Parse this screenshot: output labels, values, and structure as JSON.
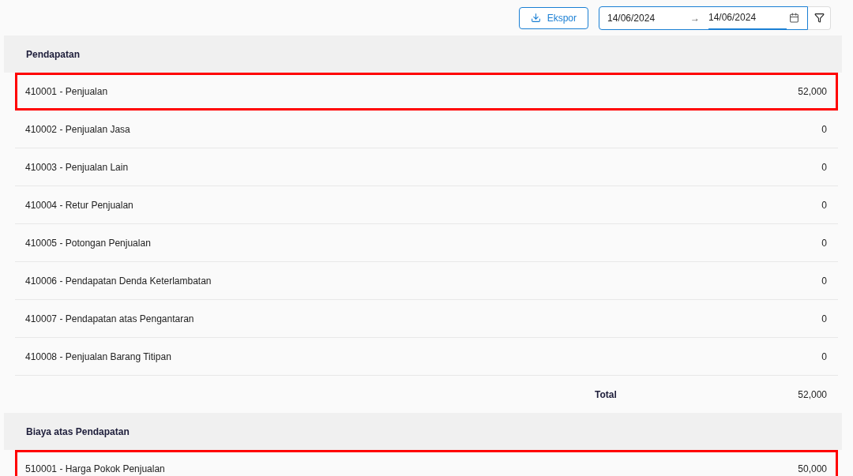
{
  "toolbar": {
    "export_label": "Ekspor",
    "date_from": "14/06/2024",
    "separator": "→",
    "date_to": "14/06/2024"
  },
  "sections": [
    {
      "title": "Pendapatan",
      "rows": [
        {
          "label": "410001 - Penjualan",
          "amount": "52,000",
          "highlighted": true
        },
        {
          "label": "410002 - Penjualan Jasa",
          "amount": "0",
          "highlighted": false
        },
        {
          "label": "410003 - Penjualan Lain",
          "amount": "0",
          "highlighted": false
        },
        {
          "label": "410004 - Retur Penjualan",
          "amount": "0",
          "highlighted": false
        },
        {
          "label": "410005 - Potongan Penjualan",
          "amount": "0",
          "highlighted": false
        },
        {
          "label": "410006 - Pendapatan Denda Keterlambatan",
          "amount": "0",
          "highlighted": false
        },
        {
          "label": "410007 - Pendapatan atas Pengantaran",
          "amount": "0",
          "highlighted": false
        },
        {
          "label": "410008 - Penjualan Barang Titipan",
          "amount": "0",
          "highlighted": false
        }
      ],
      "total_label": "Total",
      "total": "52,000"
    },
    {
      "title": "Biaya atas Pendapatan",
      "rows": [
        {
          "label": "510001 - Harga Pokok Penjualan",
          "amount": "50,000",
          "highlighted": true
        }
      ]
    }
  ]
}
